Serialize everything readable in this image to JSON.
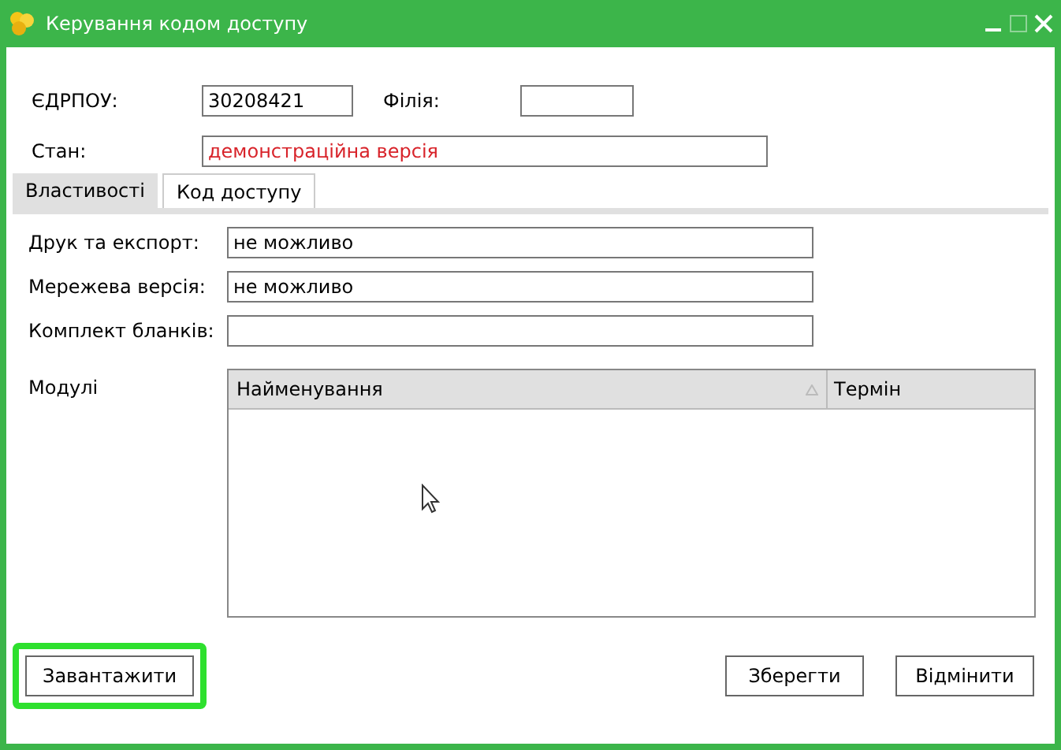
{
  "window": {
    "title": "Керування кодом доступу"
  },
  "header_fields": [
    {
      "label": "ЄДРПОУ:",
      "value": "30208421"
    },
    {
      "label": "Філія:"
    }
  ],
  "state_field": {
    "label": "Стан:",
    "value": "демонстраційна версія"
  },
  "tabs": [
    {
      "label": "Властивості",
      "selected": true
    },
    {
      "label": "Код доступу",
      "selected": false
    }
  ],
  "properties": [
    {
      "label": "Друк та експорт:",
      "value": "не можливо"
    },
    {
      "label": "Мережева версія:",
      "value": "не можливо"
    },
    {
      "label": "Комплект бланків:"
    }
  ],
  "modules": {
    "label": "Модулі",
    "columns": [
      {
        "label": "Найменування",
        "sorted": true
      },
      {
        "label": "Термін",
        "sorted": false
      }
    ]
  },
  "buttons": [
    {
      "label": "Завантажити",
      "highlighted": true
    },
    {
      "label": "Зберегти",
      "highlighted": false
    },
    {
      "label": "Відмінити",
      "highlighted": false
    }
  ]
}
